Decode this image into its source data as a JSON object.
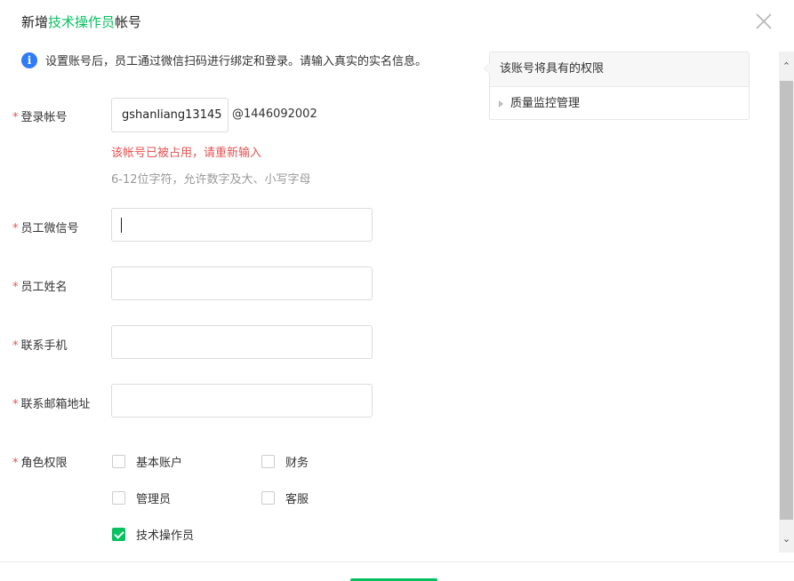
{
  "dialog": {
    "title_prefix": "新增",
    "title_accent": "技术操作员",
    "title_suffix": "帐号",
    "notice_icon": "i",
    "notice": "设置账号后，员工通过微信扫码进行绑定和登录。请输入真实的实名信息。"
  },
  "form": {
    "required_mark": "*",
    "account": {
      "label": "登录帐号",
      "value": "gshanliang13145",
      "suffix": "@1446092002",
      "error": "该帐号已被占用，请重新输入",
      "hint": "6-12位字符，允许数字及大、小写字母"
    },
    "wechat": {
      "label": "员工微信号",
      "value": ""
    },
    "name": {
      "label": "员工姓名",
      "value": ""
    },
    "phone": {
      "label": "联系手机",
      "value": ""
    },
    "email": {
      "label": "联系邮箱地址",
      "value": ""
    },
    "roles": {
      "label": "角色权限",
      "options": [
        {
          "label": "基本账户",
          "checked": false
        },
        {
          "label": "财务",
          "checked": false
        },
        {
          "label": "管理员",
          "checked": false
        },
        {
          "label": "客服",
          "checked": false
        },
        {
          "label": "技术操作员",
          "checked": true
        }
      ]
    }
  },
  "permissions_panel": {
    "title": "该账号将具有的权限",
    "items": [
      "质量监控管理"
    ]
  },
  "colors": {
    "accent": "#07c160",
    "error": "#e55353",
    "info": "#2f7cf6"
  }
}
